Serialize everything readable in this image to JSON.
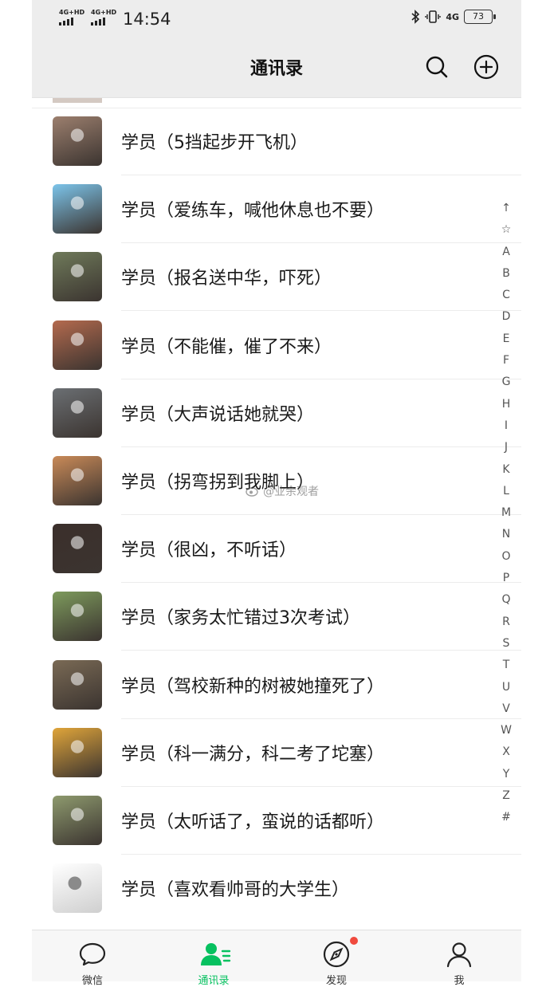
{
  "status_bar": {
    "signal_1": "4G+HD",
    "signal_2": "4G+HD",
    "time": "14:54",
    "network": "4G",
    "battery": "73"
  },
  "header": {
    "title": "通讯录",
    "icons": [
      "search-icon",
      "add-circle-icon"
    ]
  },
  "contacts": [
    {
      "name": "学员（5挡起步开飞机）",
      "avatar_color": "#9c7f6e"
    },
    {
      "name": "学员（爱练车，喊他休息也不要）",
      "avatar_color": "#7cc4ea"
    },
    {
      "name": "学员（报名送中华，吓死）",
      "avatar_color": "#6f7a5a"
    },
    {
      "name": "学员（不能催，催了不来）",
      "avatar_color": "#b46a4e"
    },
    {
      "name": "学员（大声说话她就哭）",
      "avatar_color": "#6b6f73"
    },
    {
      "name": "学员（拐弯拐到我脚上）",
      "avatar_color": "#c98a58"
    },
    {
      "name": "学员（很凶，不听话）",
      "avatar_color": "#3b2f2b"
    },
    {
      "name": "学员（家务太忙错过3次考试）",
      "avatar_color": "#7d9a5c"
    },
    {
      "name": "学员（驾校新种的树被她撞死了）",
      "avatar_color": "#7a6a55"
    },
    {
      "name": "学员（科一满分，科二考了坨塞）",
      "avatar_color": "#e0a53a"
    },
    {
      "name": "学员（太听话了，蛮说的话都听）",
      "avatar_color": "#8e9a6e"
    },
    {
      "name": "学员（喜欢看帅哥的大学生）",
      "avatar_color": "#d8d8d8"
    }
  ],
  "index_bar": [
    "↑",
    "☆",
    "A",
    "B",
    "C",
    "D",
    "E",
    "F",
    "G",
    "H",
    "I",
    "J",
    "K",
    "L",
    "M",
    "N",
    "O",
    "P",
    "Q",
    "R",
    "S",
    "T",
    "U",
    "V",
    "W",
    "X",
    "Y",
    "Z",
    "#"
  ],
  "watermark": "@业余观者",
  "tabs": [
    {
      "label": "微信",
      "icon": "chat-bubble-icon",
      "active": false
    },
    {
      "label": "通讯录",
      "icon": "contacts-icon",
      "active": true
    },
    {
      "label": "发现",
      "icon": "compass-icon",
      "active": false
    },
    {
      "label": "我",
      "icon": "person-icon",
      "active": false
    }
  ],
  "colors": {
    "accent": "#07c160",
    "badge": "#f04a3e",
    "header_bg": "#ededed"
  }
}
